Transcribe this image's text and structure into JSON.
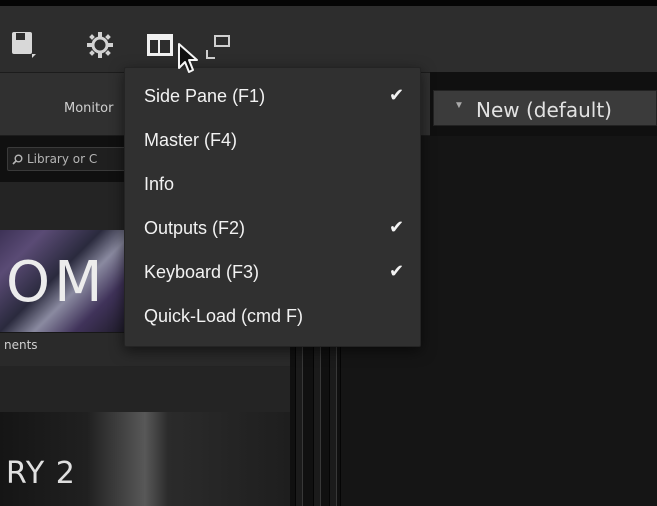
{
  "toolbar": {
    "icons": [
      "save-icon",
      "gear-icon",
      "layout-icon",
      "detach-window-icon"
    ]
  },
  "header": {
    "monitor_label": "Monitor",
    "search_placeholder": "Library or C"
  },
  "library": {
    "card1_title": "OM",
    "card1_label": "nents",
    "card2_title": "RY 2"
  },
  "preset": {
    "value": "New (default)"
  },
  "menu": {
    "items": [
      {
        "label": "Side Pane (F1)",
        "checked": "✔"
      },
      {
        "label": "Master (F4)",
        "checked": ""
      },
      {
        "label": "Info",
        "checked": ""
      },
      {
        "label": "Outputs (F2)",
        "checked": "✔"
      },
      {
        "label": "Keyboard (F3)",
        "checked": "✔"
      },
      {
        "label": "Quick-Load (cmd F)",
        "checked": ""
      }
    ]
  },
  "colors": {
    "background": "#101010",
    "menu_bg": "#303030",
    "text": "#f2f2f2"
  }
}
